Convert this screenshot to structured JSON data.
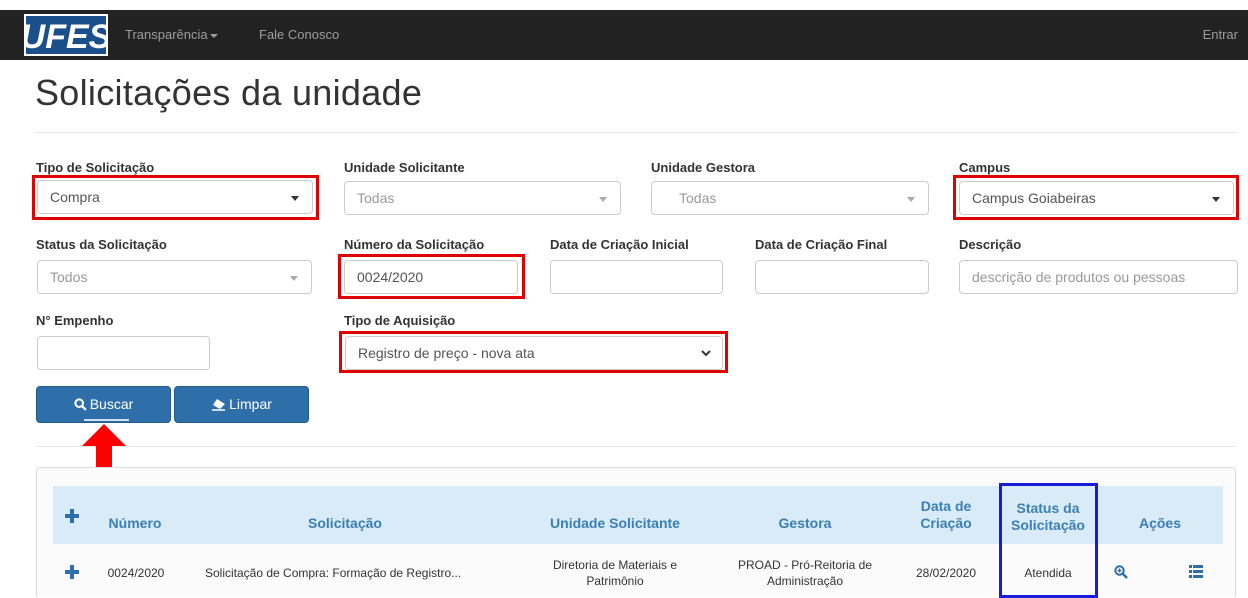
{
  "navbar": {
    "logo_text": "UFES",
    "links": [
      "Transparência",
      "Fale Conosco"
    ],
    "login": "Entrar"
  },
  "page": {
    "title": "Solicitações da unidade"
  },
  "filters": {
    "tipo_solicitacao": {
      "label": "Tipo de Solicitação",
      "value": "Compra"
    },
    "unidade_solicitante": {
      "label": "Unidade Solicitante",
      "value": "Todas"
    },
    "unidade_gestora": {
      "label": "Unidade Gestora",
      "value": "Todas"
    },
    "campus": {
      "label": "Campus",
      "value": "Campus Goiabeiras"
    },
    "status": {
      "label": "Status da Solicitação",
      "value": "Todos"
    },
    "numero": {
      "label": "Número da Solicitação",
      "value": "0024/2020"
    },
    "data_inicial": {
      "label": "Data de Criação Inicial",
      "value": ""
    },
    "data_final": {
      "label": "Data de Criação Final",
      "value": ""
    },
    "descricao": {
      "label": "Descrição",
      "placeholder": "descrição de produtos ou pessoas"
    },
    "empenho": {
      "label": "N° Empenho",
      "value": ""
    },
    "tipo_aquisicao": {
      "label": "Tipo de Aquisição",
      "value": "Registro de preço - nova ata"
    }
  },
  "buttons": {
    "buscar": "Buscar",
    "limpar": "Limpar"
  },
  "table": {
    "headers": {
      "numero": "Número",
      "solicitacao": "Solicitação",
      "unidade": "Unidade Solicitante",
      "gestora": "Gestora",
      "data_l1": "Data de",
      "data_l2": "Criação",
      "status_l1": "Status da",
      "status_l2": "Solicitação",
      "acoes": "Ações"
    },
    "rows": [
      {
        "numero": "0024/2020",
        "solicitacao": "Solicitação de Compra: Formação de Registro...",
        "unidade_l1": "Diretoria de Materiais e",
        "unidade_l2": "Patrimônio",
        "gestora_l1": "PROAD - Pró-Reitoria de",
        "gestora_l2": "Administração",
        "data": "28/02/2020",
        "status": "Atendida"
      }
    ]
  },
  "colors": {
    "annotation_red": "#e00000",
    "annotation_blue": "#1a1adb",
    "primary": "#2f6fa9"
  },
  "icons": [
    "ufes-logo",
    "search-icon",
    "eraser-icon",
    "plus-icon",
    "zoom-in-icon",
    "list-icon",
    "arrow-up-annotation"
  ]
}
